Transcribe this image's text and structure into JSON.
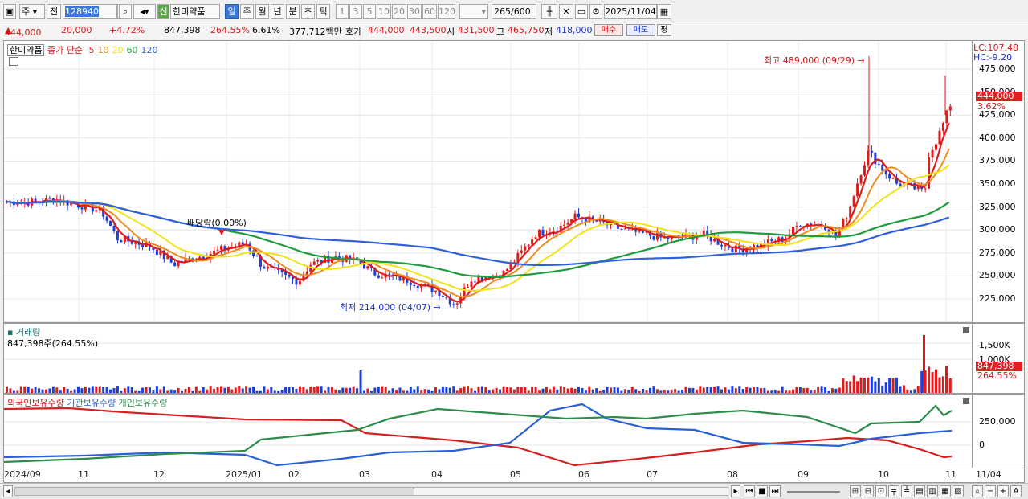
{
  "toolbar": {
    "mode1": "주",
    "mode2": "전",
    "code": "128940",
    "new_badge": "신",
    "stock_name": "한미약품",
    "periods": [
      "일",
      "주",
      "월",
      "년",
      "분",
      "초",
      "틱"
    ],
    "intervals": [
      "1",
      "3",
      "5",
      "10",
      "20",
      "30",
      "60",
      "120"
    ],
    "count": "265",
    "count_max": "/600",
    "date": "2025/11/04"
  },
  "quote": {
    "price": "444,000",
    "change": "20,000",
    "change_pct": "+4.72%",
    "volume": "847,398",
    "vol_ratio": "264.55%",
    "turnover": "6.61%",
    "amount": "377,712백만",
    "hoga_label": "호가",
    "hoga_bid": "444,000",
    "hoga_ask": "443,500",
    "open_label": "시",
    "open": "431,500",
    "high_label": "고",
    "high": "465,750",
    "low_label": "저",
    "low": "418,000",
    "buy": "매수",
    "sell": "매도",
    "avg": "평"
  },
  "price_pane": {
    "stock_label": "한미약품",
    "indicator_label": "종가 단순",
    "ma_periods": [
      "5",
      "10",
      "20",
      "60",
      "120"
    ],
    "high_note": "최고 489,000 (09/29)",
    "low_note": "최저 214,000 (04/07)",
    "dividend_note": "배당락(0.00%)",
    "lc": "LC:107.48",
    "hc": "HC:-9.20",
    "yticks": [
      "475,000",
      "450,000",
      "425,000",
      "400,000",
      "375,000",
      "350,000",
      "325,000",
      "300,000",
      "275,000",
      "250,000",
      "225,000"
    ],
    "last_price": "444,000",
    "last_pct": "3.62%"
  },
  "volume_pane": {
    "title": "거래량",
    "value": "847,398주(264.55%)",
    "yticks": [
      "1,500K",
      "1,000K"
    ],
    "last_value": "847,398",
    "last_pct": "264.55%"
  },
  "holdings_pane": {
    "labels": [
      "외국인보유수량",
      "기관보유수량",
      "개인보유수량"
    ],
    "yticks": [
      "250,000",
      "0"
    ]
  },
  "xaxis": {
    "labels": [
      "2024/09",
      "11",
      "12",
      "2025/01",
      "02",
      "03",
      "04",
      "05",
      "06",
      "07",
      "08",
      "09",
      "10",
      "11",
      "11/04"
    ]
  },
  "colors": {
    "up": "#e01b1b",
    "down": "#1b3fd8",
    "ma5": "#e01b1b",
    "ma10": "#f08c1c",
    "ma20": "#f2e21a",
    "ma60": "#1f9a3c",
    "ma120": "#2f5fdc",
    "foreign": "#d42020",
    "inst": "#2a5fd6",
    "indiv": "#2e8b4a"
  }
}
